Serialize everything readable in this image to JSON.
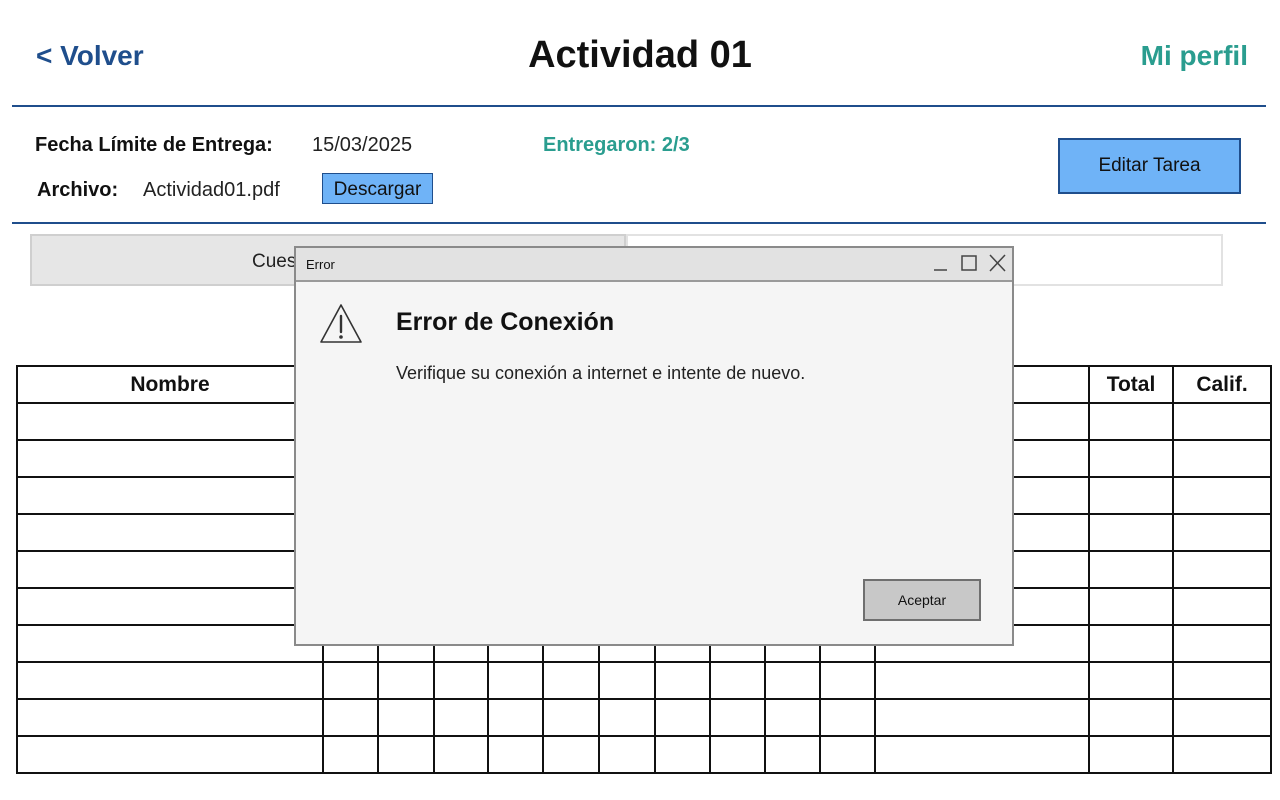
{
  "header": {
    "back_label": "< Volver",
    "title": "Actividad 01",
    "profile_label": "Mi perfil"
  },
  "task_info": {
    "deadline_label": "Fecha Límite de Entrega:",
    "deadline_value": "15/03/2025",
    "file_label": "Archivo:",
    "file_value": "Actividad01.pdf",
    "download_label": "Descargar",
    "submitted_text": "Entregaron: 2/3",
    "edit_label": "Editar Tarea"
  },
  "tabs": [
    {
      "label": "Cues"
    },
    {
      "label": ""
    }
  ],
  "table": {
    "headers": [
      "Nombre",
      "",
      "",
      "",
      "",
      "",
      "",
      "",
      "",
      "",
      "",
      "",
      "Total",
      "Calif."
    ],
    "visible_row_count": 10
  },
  "dialog": {
    "window_title": "Error",
    "heading": "Error de Conexión",
    "message": "Verifique su conexión a internet e intente de nuevo.",
    "ok_label": "Aceptar",
    "icon": "warning-icon"
  },
  "colors": {
    "primary": "#1f4e8c",
    "accent": "#2a9d8f",
    "button_fill": "#6fb3f7"
  }
}
